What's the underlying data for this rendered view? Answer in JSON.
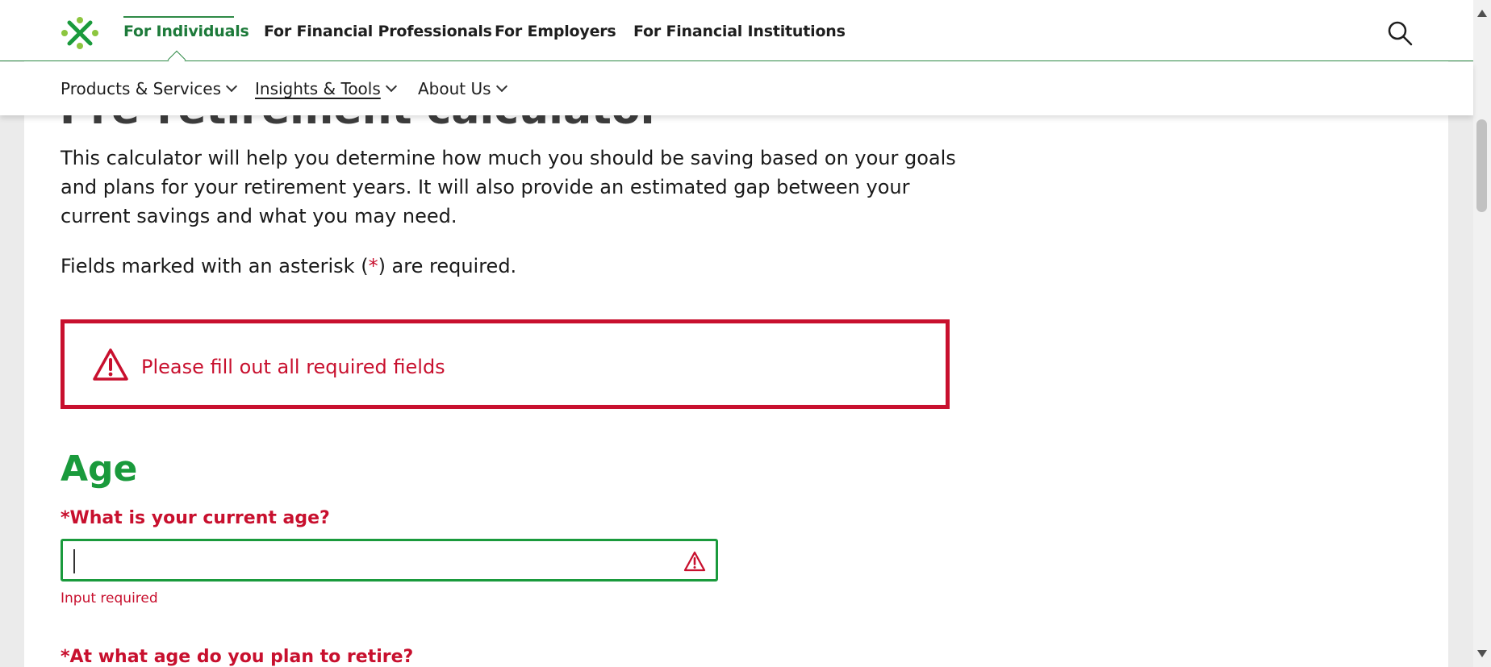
{
  "header": {
    "nav_links": [
      "For Individuals",
      "For Financial Professionals",
      "For Employers",
      "For Financial Institutions"
    ],
    "active_link": "For Individuals",
    "search_icon": "search-icon",
    "logo_icon": "brand-logo-icon"
  },
  "subnav": {
    "items": [
      "Products & Services",
      "Insights & Tools",
      "About Us"
    ]
  },
  "main": {
    "page_title": "Pre-retirement calculator",
    "intro": "This calculator will help you determine how much you should be saving based on your goals and plans for your retirement years. It will also provide an estimated gap between your current savings and what you may need.",
    "required_note_prefix": "Fields marked with an asterisk (",
    "required_note_asterisk": "*",
    "required_note_suffix": ") are required.",
    "alert": {
      "icon": "warning-triangle-icon",
      "message": "Please fill out all required fields"
    },
    "section_title": "Age",
    "questions": [
      {
        "label": "*What is your current age?",
        "value": "",
        "error": "Input required",
        "icon": "warning-triangle-icon"
      },
      {
        "label": "*At what age do you plan to retire?"
      }
    ]
  },
  "colors": {
    "brand_green": "#1a9a3c",
    "nav_active_green": "#1d7a3a",
    "error_red": "#c8102e"
  }
}
